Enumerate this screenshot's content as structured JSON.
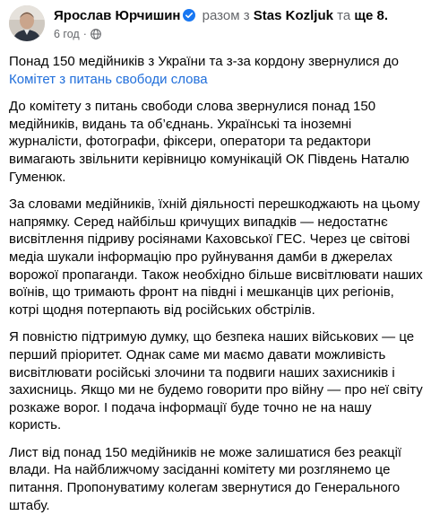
{
  "post": {
    "author": "Ярослав Юрчишин",
    "with_text": "разом з",
    "tagged_name": "Stas Kozljuk",
    "and_text": "та",
    "others": "ще 8.",
    "timestamp": "6 год",
    "lead_text": "Понад 150 медійників з України та з-за кордону звернулися до ",
    "lead_link": "Комітет з питань свободи слова",
    "paragraphs": [
      "До комітету з питань свободи слова звернулися понад 150 медійників, видань та об’єднань. Українські та іноземні журналісти, фотографи, фіксери, оператори та редактори вимагають звільнити керівницю комунікацій ОК Південь Наталю Гуменюк.",
      "За словами медійників, їхній діяльності перешкоджають на цьому напрямку. Серед найбільш кричущих випадків — недостатнє висвітлення підриву росіянами Каховської ГЕС. Через це світові медіа шукали інформацію про руйнування дамби в джерелах ворожої пропаганди. Також необхідно більше висвітлювати наших воїнів, що тримають фронт на півдні і мешканців цих регіонів, котрі щодня потерпають від російських обстрілів.",
      "Я повністю підтримую думку, що безпека наших військових — це перший пріоритет. Однак саме ми маємо давати можливість висвітлювати російські злочини та подвиги наших захисників і захисниць. Якщо ми не будемо говорити про війну — про неї світу розкаже ворог. І подача інформації буде точно не на нашу користь.",
      "Лист від понад 150 медійників не може залишатися без реакції влади. На найближчому засіданні комітету ми розглянемо це питання. Пропонуватиму колегам звернутися до Генерального штабу."
    ],
    "icons": {
      "verified": "verified-badge-icon",
      "privacy": "globe-icon"
    },
    "colors": {
      "link": "#216fdb",
      "verified": "#1877f2",
      "meta": "#65676b"
    }
  }
}
